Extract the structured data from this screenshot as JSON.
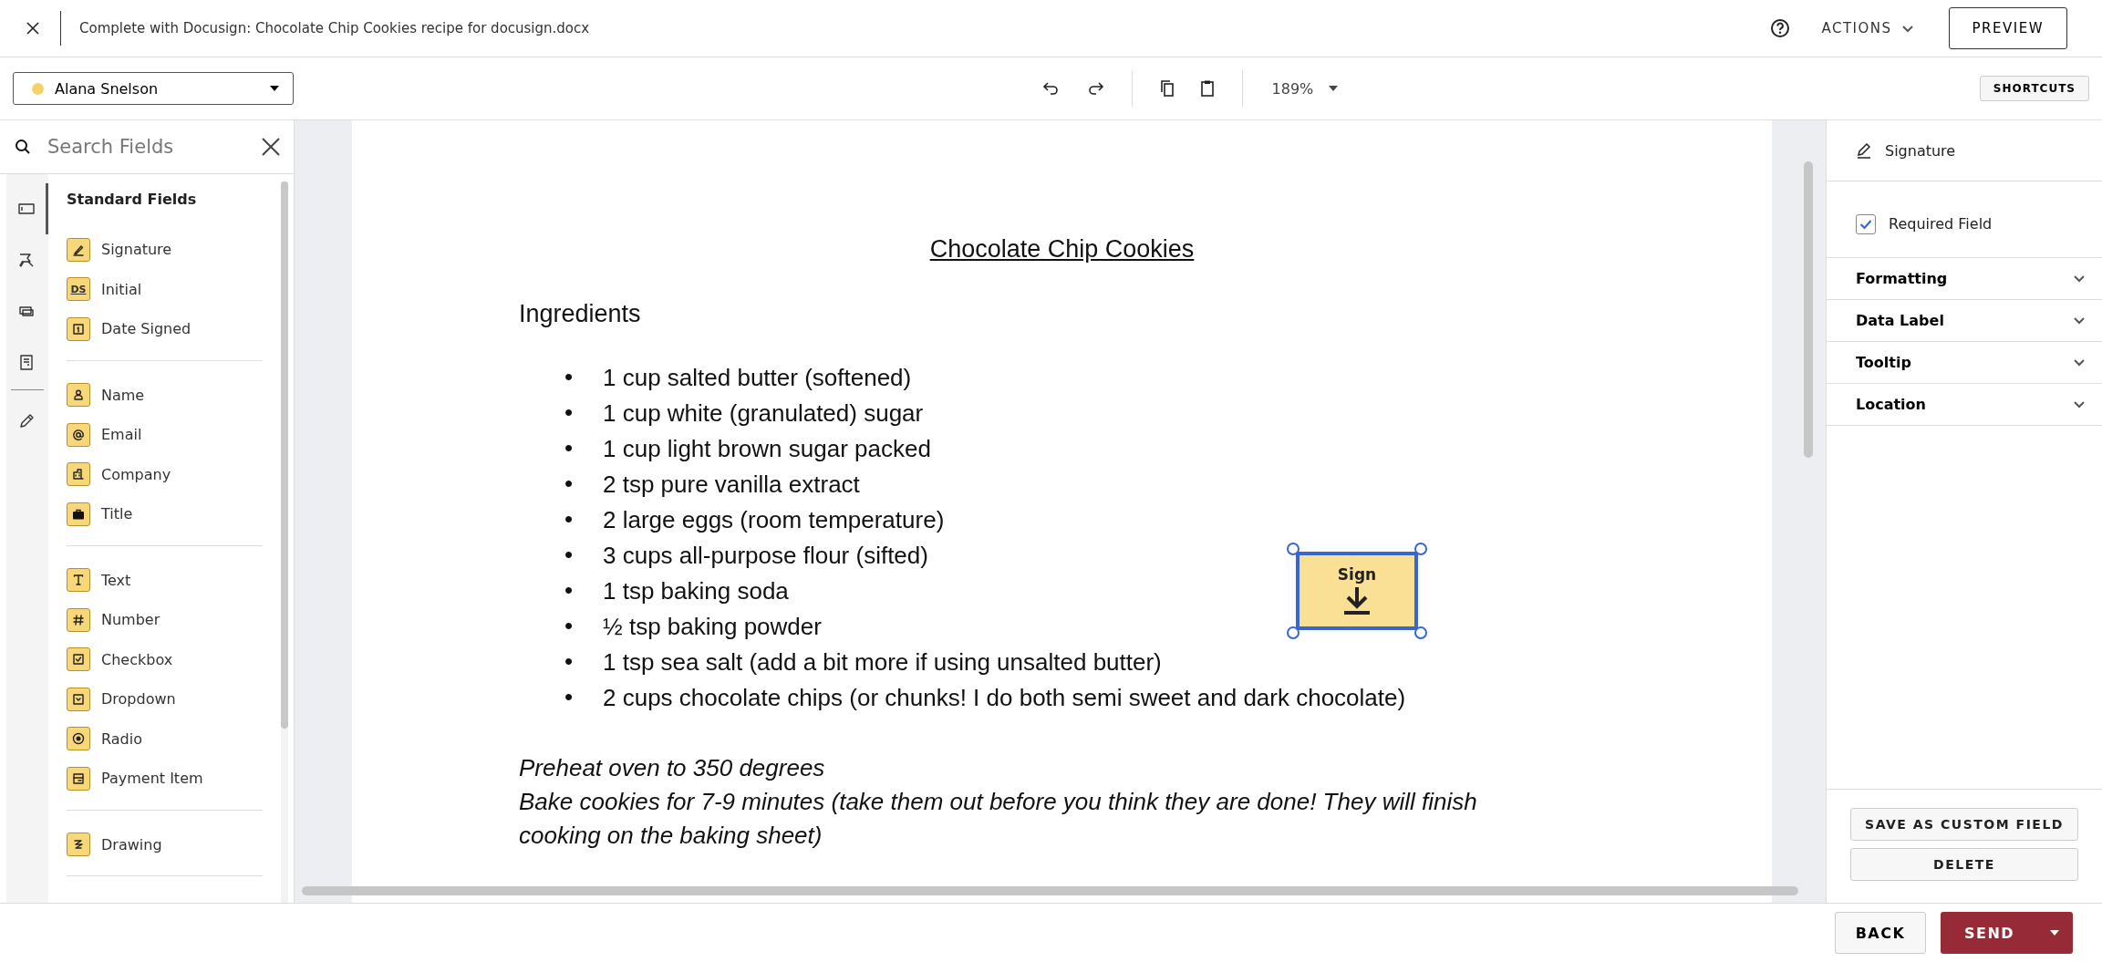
{
  "top_bar": {
    "title": "Complete with Docusign: Chocolate Chip Cookies recipe for docusign.docx",
    "actions": "ACTIONS",
    "preview": "PREVIEW"
  },
  "toolbar": {
    "recipient": {
      "name": "Alana Snelson",
      "color": "#f6d16b"
    },
    "zoom": "189%",
    "shortcuts": "SHORTCUTS"
  },
  "sidebar": {
    "search": {
      "placeholder": "Search Fields"
    },
    "rail": [
      {
        "kind": "standard",
        "selected": true
      },
      {
        "kind": "tools",
        "selected": false
      },
      {
        "kind": "cards",
        "selected": false
      },
      {
        "kind": "document",
        "selected": false
      },
      {
        "kind": "pencil",
        "selected": false
      }
    ],
    "heading": "Standard Fields",
    "groups": [
      [
        {
          "kind": "signature",
          "label": "Signature"
        },
        {
          "kind": "initial",
          "label": "Initial",
          "badge": "DS"
        },
        {
          "kind": "date",
          "label": "Date Signed"
        }
      ],
      [
        {
          "kind": "name",
          "label": "Name"
        },
        {
          "kind": "email",
          "label": "Email"
        },
        {
          "kind": "company",
          "label": "Company"
        },
        {
          "kind": "title",
          "label": "Title"
        }
      ],
      [
        {
          "kind": "text",
          "label": "Text"
        },
        {
          "kind": "number",
          "label": "Number"
        },
        {
          "kind": "checkbox",
          "label": "Checkbox"
        },
        {
          "kind": "dropdown",
          "label": "Dropdown"
        },
        {
          "kind": "radio",
          "label": "Radio"
        },
        {
          "kind": "payment",
          "label": "Payment Item"
        }
      ],
      [
        {
          "kind": "drawing",
          "label": "Drawing"
        }
      ]
    ]
  },
  "document": {
    "title": "Chocolate Chip Cookies",
    "heading": "Ingredients",
    "bullet": "•",
    "ingredients": [
      "1 cup salted butter (softened)",
      "1 cup white (granulated) sugar",
      "1 cup light brown sugar packed",
      "2 tsp pure vanilla extract",
      "2 large eggs (room temperature)",
      "3 cups all-purpose flour (sifted)",
      "1 tsp baking soda",
      "½ tsp baking powder",
      "1 tsp sea salt (add a bit more if using unsalted butter)",
      "2 cups chocolate chips (or chunks! I do both semi sweet and dark chocolate)"
    ],
    "instructions": [
      "Preheat oven to 350 degrees",
      "Bake cookies for 7-9 minutes (take them out before you think they are done! They will finish cooking on the baking sheet)"
    ],
    "fields": [
      {
        "kind": "signature",
        "label": "Sign",
        "selected": true
      }
    ]
  },
  "properties": {
    "field_type": "Signature",
    "required": {
      "label": "Required Field",
      "checked": true
    },
    "sections": [
      {
        "label": "Formatting",
        "expanded": false
      },
      {
        "label": "Data Label",
        "expanded": false
      },
      {
        "label": "Tooltip",
        "expanded": false
      },
      {
        "label": "Location",
        "expanded": false
      }
    ],
    "buttons": [
      "SAVE AS CUSTOM FIELD",
      "DELETE"
    ]
  },
  "footer": {
    "back": "BACK",
    "send": "SEND"
  }
}
